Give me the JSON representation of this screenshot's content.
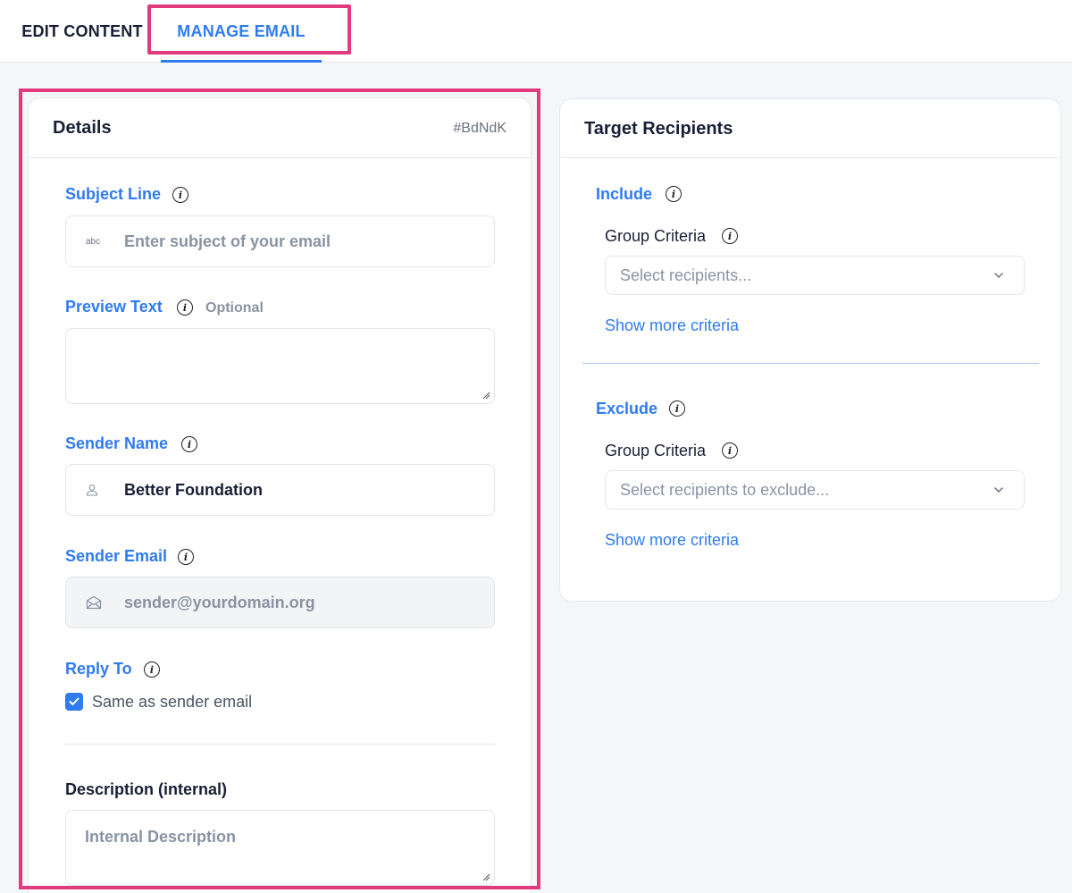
{
  "tabs": [
    {
      "label": "EDIT CONTENT"
    },
    {
      "label": "MANAGE EMAIL"
    }
  ],
  "details": {
    "title": "Details",
    "id": "#BdNdK",
    "subject": {
      "label": "Subject Line",
      "icon_text": "abc",
      "placeholder": "Enter subject of your email"
    },
    "preview": {
      "label": "Preview Text",
      "optional": "Optional",
      "value": ""
    },
    "sender_name": {
      "label": "Sender Name",
      "icon": "person-icon",
      "value": "Better Foundation"
    },
    "sender_email": {
      "label": "Sender Email",
      "icon": "envelope-icon",
      "value": "sender@yourdomain.org"
    },
    "reply_to": {
      "label": "Reply To",
      "checkbox_label": "Same as sender email",
      "checked": true
    },
    "description": {
      "label": "Description (internal)",
      "placeholder": "Internal Description"
    }
  },
  "target": {
    "title": "Target Recipients",
    "include": {
      "label": "Include",
      "group_label": "Group Criteria",
      "select_placeholder": "Select recipients...",
      "more_link": "Show more criteria"
    },
    "exclude": {
      "label": "Exclude",
      "group_label": "Group Criteria",
      "select_placeholder": "Select recipients to exclude...",
      "more_link": "Show more criteria"
    }
  },
  "colors": {
    "accent": "#2f7bf0",
    "highlight": "#e23a7f"
  }
}
